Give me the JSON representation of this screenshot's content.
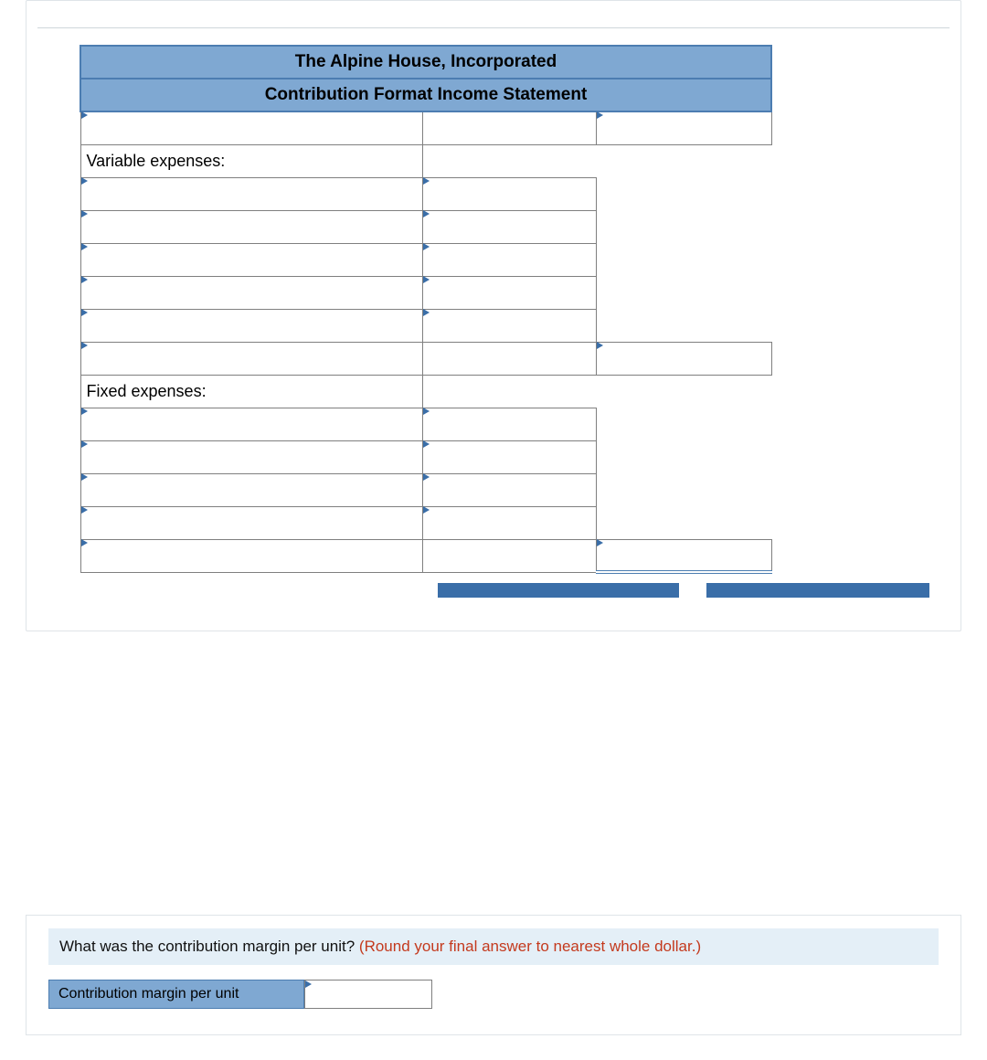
{
  "statement": {
    "title1": "The Alpine House, Incorporated",
    "title2": "Contribution Format Income Statement",
    "rows": [
      {
        "label": "",
        "c1": "",
        "c2": "",
        "tri": [
          true,
          false,
          true
        ]
      },
      {
        "label": "Variable expenses:",
        "c1": "",
        "c2": "",
        "tri": [
          false,
          false,
          false
        ],
        "labelPlain": true
      },
      {
        "label": "",
        "c1": "",
        "c2": "",
        "tri": [
          true,
          true,
          false
        ],
        "noC2": true
      },
      {
        "label": "",
        "c1": "",
        "c2": "",
        "tri": [
          true,
          true,
          false
        ],
        "noC2": true
      },
      {
        "label": "",
        "c1": "",
        "c2": "",
        "tri": [
          true,
          true,
          false
        ],
        "noC2": true
      },
      {
        "label": "",
        "c1": "",
        "c2": "",
        "tri": [
          true,
          true,
          false
        ],
        "noC2": true
      },
      {
        "label": "",
        "c1": "",
        "c2": "",
        "tri": [
          true,
          true,
          false
        ],
        "noC2": true
      },
      {
        "label": "",
        "c1": "",
        "c2": "",
        "tri": [
          true,
          false,
          true
        ]
      },
      {
        "label": "Fixed expenses:",
        "c1": "",
        "c2": "",
        "tri": [
          false,
          false,
          false
        ],
        "labelPlain": true
      },
      {
        "label": "",
        "c1": "",
        "c2": "",
        "tri": [
          true,
          true,
          false
        ],
        "noC2": true
      },
      {
        "label": "",
        "c1": "",
        "c2": "",
        "tri": [
          true,
          true,
          false
        ],
        "noC2": true
      },
      {
        "label": "",
        "c1": "",
        "c2": "",
        "tri": [
          true,
          true,
          false
        ],
        "noC2": true
      },
      {
        "label": "",
        "c1": "",
        "c2": "",
        "tri": [
          true,
          true,
          false
        ],
        "noC2": true
      },
      {
        "label": "",
        "c1": "",
        "c2": "",
        "tri": [
          true,
          false,
          true
        ],
        "underline": true
      }
    ]
  },
  "question": {
    "prompt": "What was the contribution margin per unit?",
    "hint": "(Round your final answer to nearest whole dollar.)",
    "answer_label": "Contribution margin per unit",
    "answer_value": ""
  }
}
